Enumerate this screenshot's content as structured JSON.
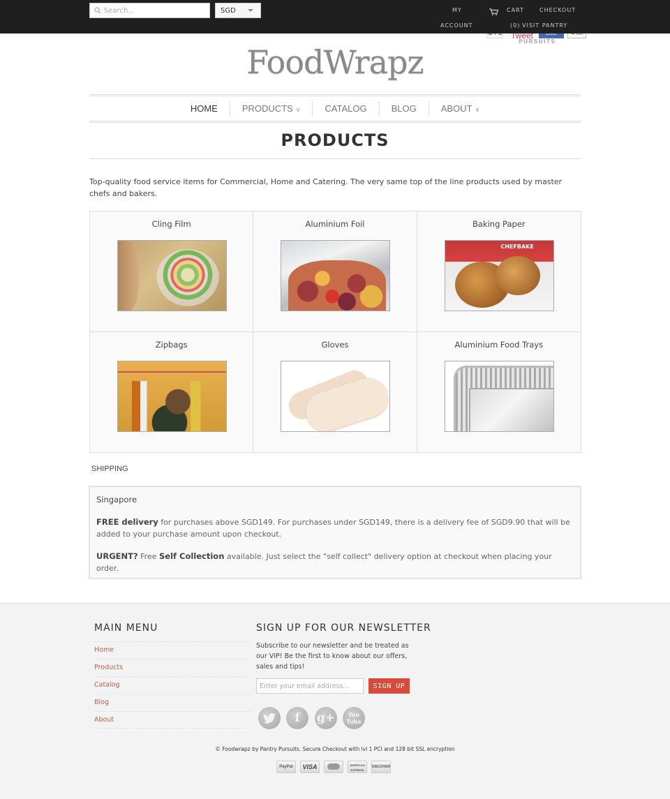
{
  "topbar": {
    "search_placeholder": "Search...",
    "currency": "SGD",
    "my_account_line1": "MY",
    "my_account_line2": "ACCOUNT",
    "cart": "CART",
    "cart_count": "(0)",
    "checkout": "CHECKOUT",
    "visit_pantry": "VISIT PANTRY"
  },
  "social_share": {
    "gplus": "G+1",
    "tweet": "Tweet",
    "fb_like": "Like",
    "fb_count": "4.8k",
    "pursuits_label": "PURSUITS"
  },
  "logo": {
    "text": "FoodWrapz"
  },
  "nav": {
    "items": [
      {
        "label": "HOME",
        "has_dropdown": false
      },
      {
        "label": "PRODUCTS",
        "has_dropdown": true
      },
      {
        "label": "CATALOG",
        "has_dropdown": false
      },
      {
        "label": "BLOG",
        "has_dropdown": false
      },
      {
        "label": "ABOUT",
        "has_dropdown": true
      }
    ],
    "dropdown_glyph": "∨"
  },
  "page": {
    "title": "PRODUCTS",
    "intro": "Top-quality food service items for Commercial, Home and Catering. The very same top of the line products used by master chefs and bakers."
  },
  "products": [
    {
      "name": "Cling Film"
    },
    {
      "name": "Aluminium Foil"
    },
    {
      "name": "Baking Paper"
    },
    {
      "name": "Zipbags"
    },
    {
      "name": "Gloves"
    },
    {
      "name": "Aluminium Food Trays"
    }
  ],
  "baking_label": "CHEFBAKE",
  "shipping": {
    "label": "SHIPPING",
    "region": "Singapore",
    "free_delivery_bold": "FREE delivery",
    "free_delivery_text": " for purchases above SGD149. For purchases under SGD149, there is a delivery fee of SGD9.90 that will be added to your purchase amount upon checkout.",
    "urgent_bold": "URGENT?",
    "urgent_text_1": " Free ",
    "self_collection_bold": "Self Collection",
    "urgent_text_2": " available. Just select the \"self collect\" delivery option at checkout when placing your order."
  },
  "footer": {
    "main_menu_heading": "MAIN MENU",
    "menu_items": [
      "Home",
      "Products",
      "Catalog",
      "Blog",
      "About"
    ],
    "newsletter_heading": "SIGN UP FOR OUR NEWSLETTER",
    "newsletter_text": "Subscribe to our newsletter and be treated as our VIP! Be the first to know about our offers, sales and tips!",
    "email_placeholder": "Enter your email address...",
    "signup_label": "SIGN UP",
    "social_icons": [
      "twitter-icon",
      "facebook-icon",
      "google-plus-icon",
      "youtube-icon"
    ],
    "social_glyphs": {
      "twitter": "🐦",
      "facebook": "f",
      "google": "g+",
      "youtube": "You Tube"
    },
    "copyright": "© Foodwrapz by Pantry Pursuits. Secure Checkout with lvl 1 PCI and 128 bit SSL encryption",
    "payments": [
      "PayPal",
      "VISA",
      "MasterCard",
      "American Express",
      "DISCOVER"
    ],
    "payment_labels": {
      "paypal": "PayPal",
      "visa": "VISA",
      "amex": "AMERICAN EXPRESS",
      "discover": "DISCOVER"
    }
  },
  "colors": {
    "topbar_bg": "#1f1f1f",
    "link_accent": "#b4614f",
    "signup_button": "#d84a3a",
    "footer_bg": "#f3f3f3"
  }
}
